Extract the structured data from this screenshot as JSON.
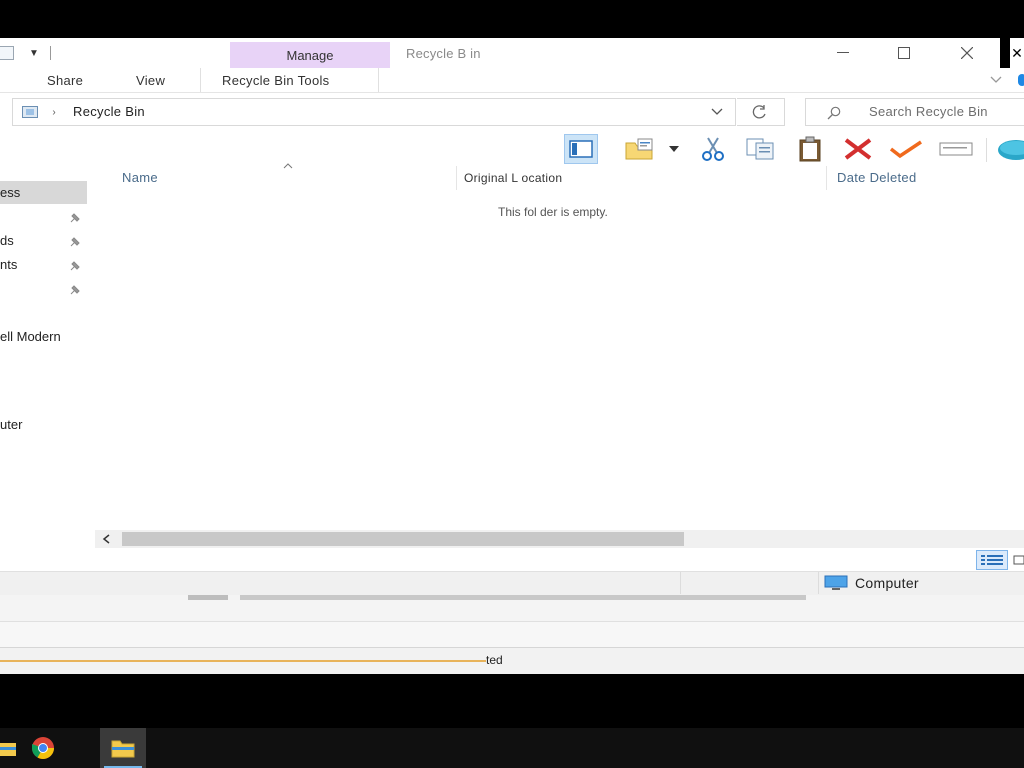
{
  "window": {
    "title": "Recycle B   in",
    "manage_tab": "Manage"
  },
  "ribbon": {
    "tabs": [
      "Share",
      "View",
      "Recycle Bin Tools"
    ]
  },
  "address": {
    "location": "Recycle Bin",
    "search_placeholder": "Search Recycle Bin"
  },
  "nav": {
    "items": [
      "ess",
      "",
      "ds",
      "nts",
      "",
      "ell Modern",
      "uter"
    ]
  },
  "columns": [
    "Name",
    "Original L     ocation",
    "Date Deleted"
  ],
  "content": {
    "empty_message": "This fol     der is empty."
  },
  "status": {
    "computer_label": "Computer",
    "bottom_text": "ted"
  },
  "colors": {
    "manage_tab_bg": "#e8d3f7",
    "accent_blue": "#1e88e5",
    "delete_red": "#d32f2f",
    "restore_orange": "#f06a1d"
  }
}
